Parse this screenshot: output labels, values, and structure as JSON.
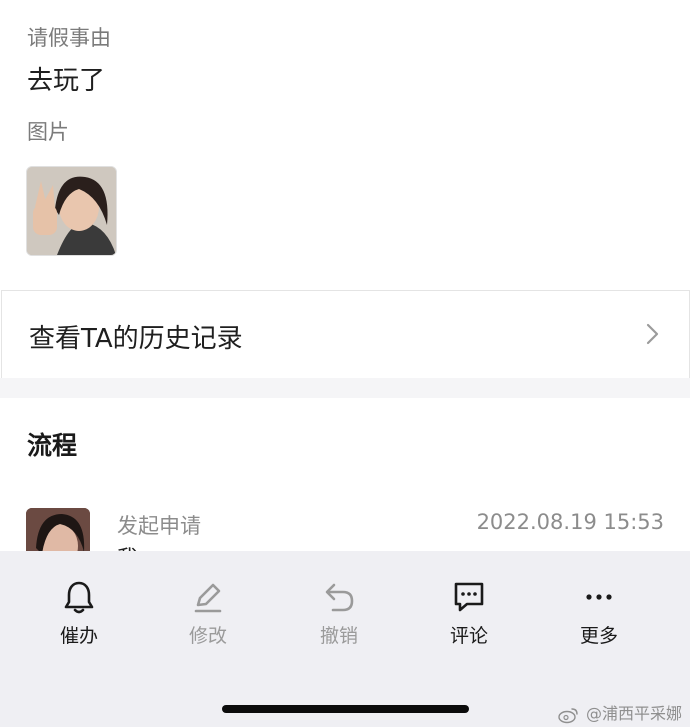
{
  "form": {
    "reason_label": "请假事由",
    "reason_value": "去玩了",
    "images_label": "图片"
  },
  "history_link": {
    "label": "查看TA的历史记录"
  },
  "flow": {
    "title": "流程",
    "step": {
      "action": "发起申请",
      "time": "2022.08.19 15:53",
      "user": "我"
    }
  },
  "tabbar": {
    "items": [
      {
        "label": "催办",
        "icon": "bell-icon",
        "enabled": true
      },
      {
        "label": "修改",
        "icon": "pencil-icon",
        "enabled": false
      },
      {
        "label": "撤销",
        "icon": "undo-icon",
        "enabled": false
      },
      {
        "label": "评论",
        "icon": "comment-icon",
        "enabled": true
      },
      {
        "label": "更多",
        "icon": "more-icon",
        "enabled": true
      }
    ]
  },
  "watermark": {
    "text": "@浦西平采娜"
  },
  "colors": {
    "label_gray": "#7b7b7b",
    "text_dark": "#1f1f1f",
    "tabbar_bg": "#efeff3",
    "disabled": "#9a9a9a"
  }
}
